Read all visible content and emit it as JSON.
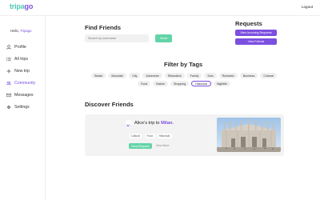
{
  "header": {
    "logo_part1": "tripa",
    "logo_part2": "go",
    "logout_label": "Logout"
  },
  "sidebar": {
    "greeting": "Hello, ",
    "username": "Tripago",
    "items": [
      {
        "label": "Profile",
        "icon": "user-icon"
      },
      {
        "label": "All trips",
        "icon": "list-icon"
      },
      {
        "label": "New trip",
        "icon": "plus-icon"
      },
      {
        "label": "Community",
        "icon": "community-icon",
        "active": true
      },
      {
        "label": "Messages",
        "icon": "mail-icon"
      },
      {
        "label": "Settings",
        "icon": "gear-icon"
      }
    ]
  },
  "find_friends": {
    "title": "Find Friends",
    "search_placeholder": "Search by username",
    "send_label": "Send"
  },
  "requests": {
    "title": "Requests",
    "incoming_label": "View Incoming Requests",
    "friends_label": "View Friends"
  },
  "filter": {
    "title": "Filter by Tags",
    "tags": [
      "Beach",
      "Mountain",
      "City",
      "Adventure",
      "Relaxation",
      "Family",
      "Solo",
      "Romantic",
      "Business",
      "Cultural",
      "Food",
      "Nature",
      "Shopping",
      "Historical",
      "Nightlife"
    ],
    "selected": "Historical"
  },
  "discover": {
    "title": "Discover Friends",
    "card": {
      "title_prefix": "Alice's trip to ",
      "destination": "Milan.",
      "tags": [
        "Cultural",
        "Food",
        "Historical"
      ],
      "send_request_label": "Send Request",
      "view_more_label": "View More"
    }
  },
  "colors": {
    "accent": "#7c4fe0",
    "teal": "#63d4a8"
  }
}
